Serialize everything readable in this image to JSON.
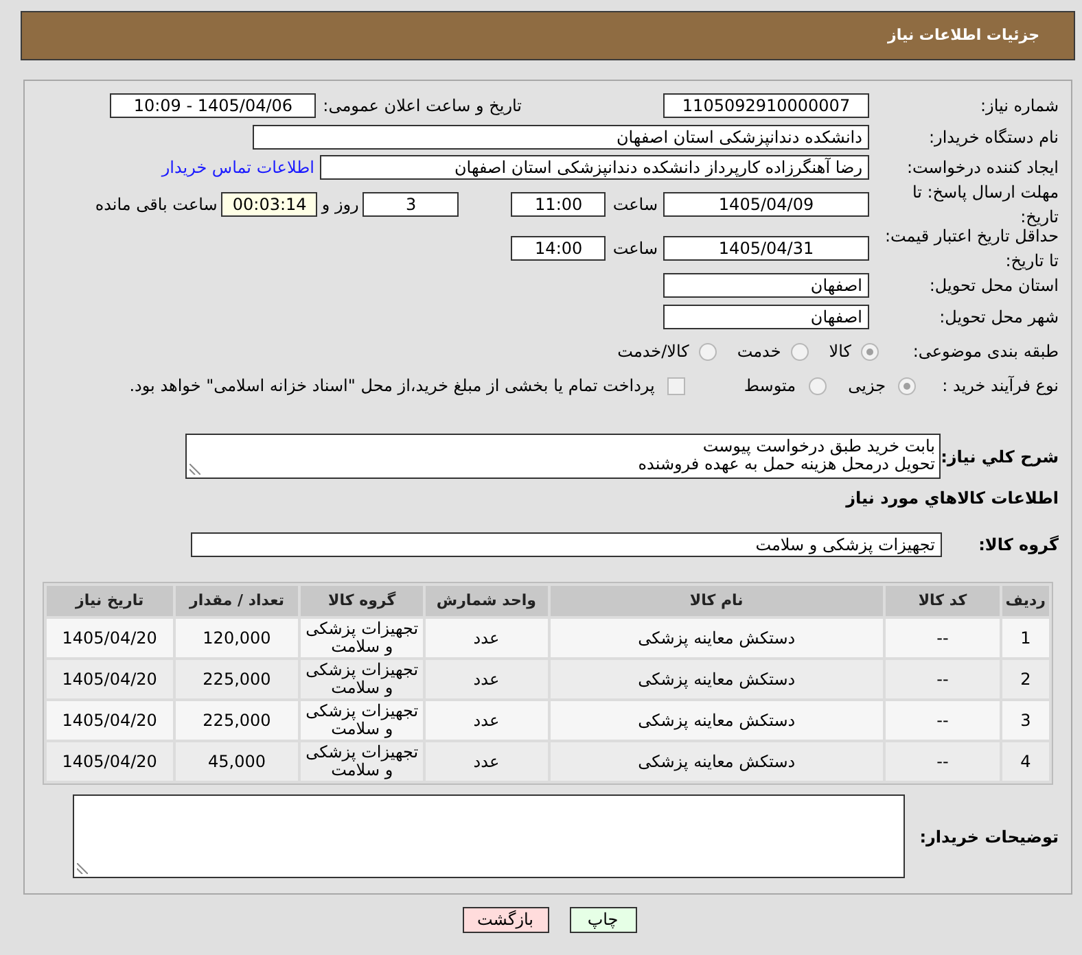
{
  "window": {
    "title": "جزئیات اطلاعات نیاز"
  },
  "form": {
    "need_number": {
      "label": "شماره نیاز:",
      "value": "1105092910000007"
    },
    "announce_datetime": {
      "label": "تاریخ و ساعت اعلان عمومی:",
      "value": "1405/04/06 - 10:09"
    },
    "buyer_org": {
      "label": "نام دستگاه خریدار:",
      "value": "دانشکده دندانپزشکی استان اصفهان"
    },
    "requester": {
      "label": "ایجاد کننده درخواست:",
      "value": "رضا آهنگرزاده کارپرداز دانشکده دندانپزشکی استان اصفهان",
      "link": "اطلاعات تماس خریدار"
    },
    "response_deadline": {
      "label": "مهلت ارسال پاسخ: تا تاریخ:",
      "date": "1405/04/09",
      "time_label": "ساعت",
      "time": "11:00",
      "days": "3",
      "days_label": "روز و",
      "remaining": "00:03:14",
      "remaining_label": "ساعت باقی مانده"
    },
    "price_validity": {
      "label": "حداقل تاریخ اعتبار قیمت: تا تاریخ:",
      "date": "1405/04/31",
      "time_label": "ساعت",
      "time": "14:00"
    },
    "delivery_province": {
      "label": "استان محل تحویل:",
      "value": "اصفهان"
    },
    "delivery_city": {
      "label": "شهر محل تحویل:",
      "value": "اصفهان"
    },
    "classification": {
      "label": "طبقه بندی موضوعی:",
      "options": [
        {
          "label": "کالا",
          "selected": true
        },
        {
          "label": "خدمت",
          "selected": false
        },
        {
          "label": "کالا/خدمت",
          "selected": false
        }
      ]
    },
    "purchase_process": {
      "label": "نوع فرآیند خرید :",
      "options": [
        {
          "label": "جزیی",
          "selected": true
        },
        {
          "label": "متوسط",
          "selected": false
        }
      ],
      "treasury": {
        "label": "پرداخت تمام یا بخشی از مبلغ خرید،از محل \"اسناد خزانه اسلامی\" خواهد بود.",
        "checked": false
      }
    }
  },
  "description": {
    "label": "شرح کلي نياز:",
    "lines": [
      "بابت خرید طبق درخواست پیوست",
      "تحویل درمحل هزینه حمل به عهده فروشنده"
    ]
  },
  "items_section": {
    "title": "اطلاعات کالاهاي مورد نياز",
    "group_label": "گروه کالا:",
    "group_value": "تجهیزات پزشکی و سلامت"
  },
  "table": {
    "columns": [
      "ردیف",
      "کد کالا",
      "نام کالا",
      "واحد شمارش",
      "گروه کالا",
      "تعداد / مقدار",
      "تاریخ نیاز"
    ],
    "rows": [
      [
        "1",
        "--",
        "دستکش معاینه پزشکی",
        "عدد",
        "تجهیزات پزشکی و سلامت",
        "120,000",
        "1405/04/20"
      ],
      [
        "2",
        "--",
        "دستکش معاینه پزشکی",
        "عدد",
        "تجهیزات پزشکی و سلامت",
        "225,000",
        "1405/04/20"
      ],
      [
        "3",
        "--",
        "دستکش معاینه پزشکی",
        "عدد",
        "تجهیزات پزشکی و سلامت",
        "225,000",
        "1405/04/20"
      ],
      [
        "4",
        "--",
        "دستکش معاینه پزشکی",
        "عدد",
        "تجهیزات پزشکی و سلامت",
        "45,000",
        "1405/04/20"
      ]
    ]
  },
  "buyer_notes": {
    "label": "توضیحات خریدار:"
  },
  "buttons": [
    {
      "label": "چاپ",
      "kind": "print"
    },
    {
      "label": "بازگشت",
      "kind": "back"
    }
  ]
}
